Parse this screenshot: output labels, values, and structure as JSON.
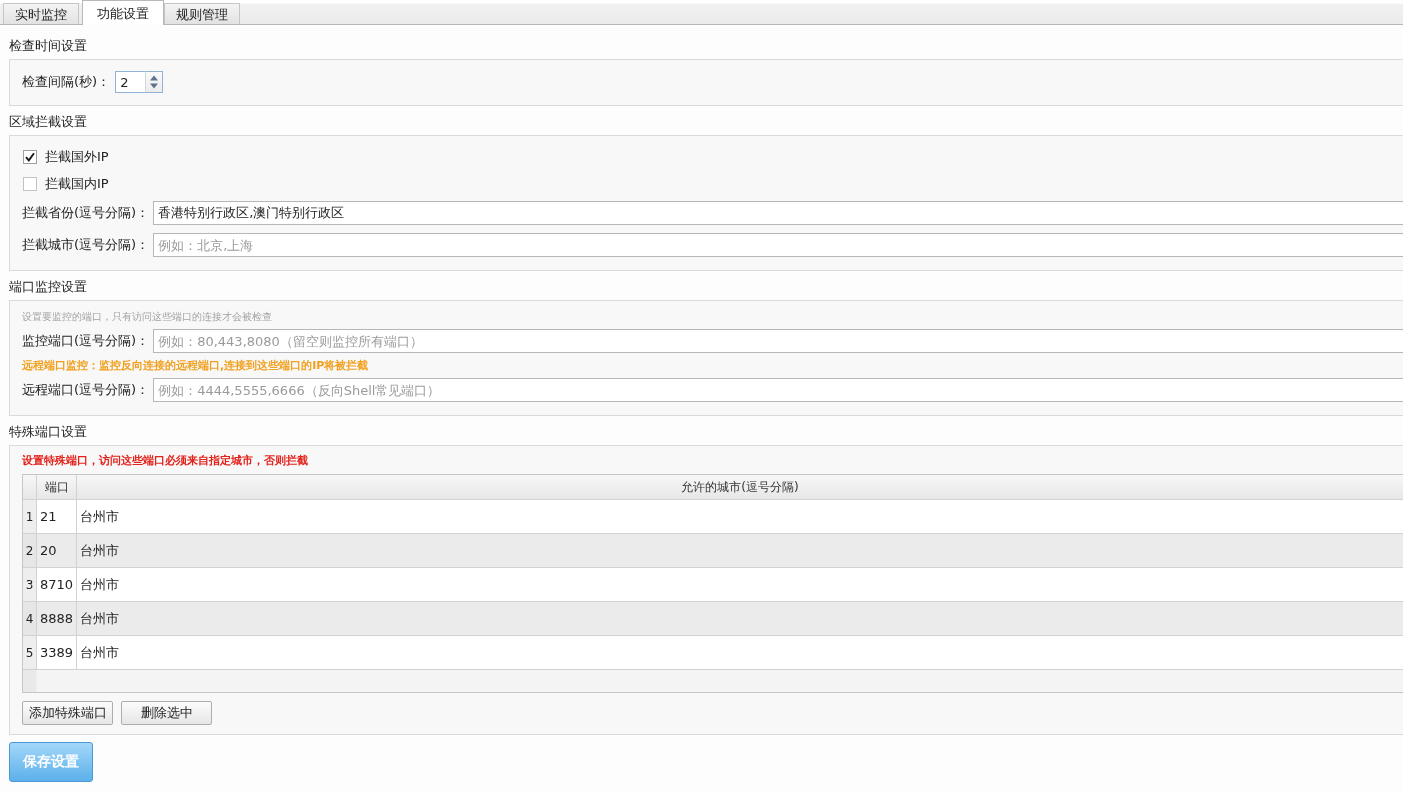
{
  "tabs": [
    {
      "label": "实时监控",
      "selected": false
    },
    {
      "label": "功能设置",
      "selected": true
    },
    {
      "label": "规则管理",
      "selected": false
    }
  ],
  "sections": [
    {
      "title": "检查时间设置",
      "items": [
        {
          "kind": "spinner",
          "label": "检查间隔(秒)：",
          "value": "2"
        }
      ]
    },
    {
      "title": "区域拦截设置",
      "items": [
        {
          "kind": "checkbox",
          "label": "拦截国外IP",
          "checked": true
        },
        {
          "kind": "checkbox",
          "label": "拦截国内IP",
          "checked": false
        },
        {
          "kind": "field",
          "label": "拦截省份(逗号分隔)：",
          "value": "香港特别行政区,澳门特别行政区"
        },
        {
          "kind": "field",
          "label": "拦截城市(逗号分隔)：",
          "placeholder": "例如：北京,上海"
        }
      ]
    },
    {
      "title": "端口监控设置",
      "items": [
        {
          "kind": "hint",
          "text": "设置要监控的端口，只有访问这些端口的连接才会被检查"
        },
        {
          "kind": "field",
          "label": "监控端口(逗号分隔)：",
          "placeholder": "例如：80,443,8080（留空则监控所有端口）"
        },
        {
          "kind": "warning",
          "text": "远程端口监控：监控反向连接的远程端口,连接到这些端口的IP将被拦截"
        },
        {
          "kind": "field",
          "label": "远程端口(逗号分隔)：",
          "placeholder": "例如：4444,5555,6666（反向Shell常见端口）"
        }
      ]
    },
    {
      "title": "特殊端口设置",
      "items": [
        {
          "kind": "alert",
          "text": "设置特殊端口，访问这些端口必须来自指定城市，否则拦截"
        },
        {
          "kind": "table",
          "columns": [
            "端口",
            "允许的城市(逗号分隔)"
          ],
          "rows": [
            {
              "number": "1",
              "port": "21",
              "city": "台州市"
            },
            {
              "number": "2",
              "port": "20",
              "city": "台州市"
            },
            {
              "number": "3",
              "port": "8710",
              "city": "台州市"
            },
            {
              "number": "4",
              "port": "8888",
              "city": "台州市"
            },
            {
              "number": "5",
              "port": "3389",
              "city": "台州市"
            }
          ]
        },
        {
          "kind": "buttons",
          "buttons": [
            "添加特殊端口",
            "删除选中"
          ]
        }
      ]
    }
  ],
  "save_button": "保存设置"
}
